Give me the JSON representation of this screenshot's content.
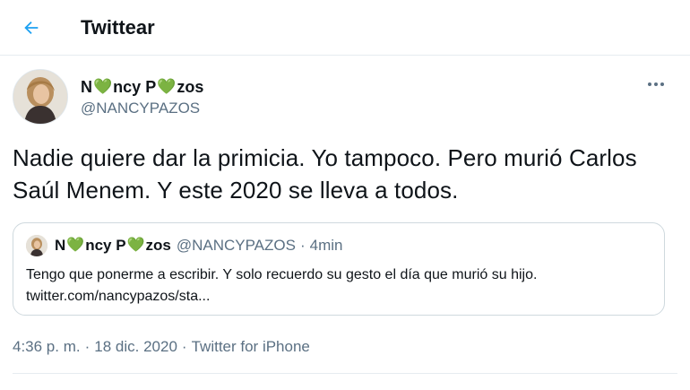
{
  "header": {
    "title": "Twittear",
    "back_icon": "arrow-left-icon",
    "accent": "#1da1f2"
  },
  "author": {
    "name_parts": [
      "N",
      "ncy P",
      "zos"
    ],
    "heart_glyph": "💚",
    "heart_color": "#5cbf3a",
    "handle": "@NANCYPAZOS"
  },
  "tweet": {
    "text": "Nadie quiere dar la primicia. Yo tampoco. Pero murió Carlos Saúl Menem. Y este 2020 se lleva a todos."
  },
  "quoted": {
    "name_parts": [
      "N",
      "ncy P",
      "zos"
    ],
    "handle": "@NANCYPAZOS",
    "separator": "·",
    "time": "4min",
    "text": "Tengo que ponerme a escribir. Y solo recuerdo su gesto el día que murió su hijo.",
    "link": "twitter.com/nancypazos/sta..."
  },
  "meta": {
    "time": "4:36 p. m.",
    "separator": "·",
    "date": "18 dic. 2020",
    "source": "Twitter for iPhone"
  }
}
